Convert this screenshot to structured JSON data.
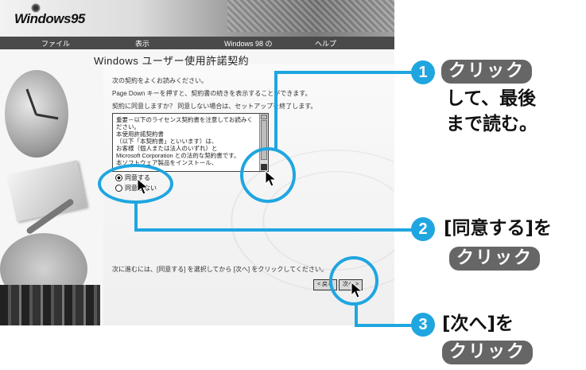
{
  "screenshot": {
    "logo": "Windows95",
    "menu": [
      "ファイル",
      "表示",
      "Windows 98 の",
      "ヘルプ"
    ],
    "wizard_title": "Windows ユーザー使用許諾契約",
    "instructions": [
      "次の契約をよくお読みください。",
      "Page Down キーを押すと、契約書の続きを表示することができます。",
      "契約に同意しますか？ 同意しない場合は、セットアップを終了します。"
    ],
    "license_lines": [
      "重要－以下のライセンス契約書を注意してお読みください。",
      "本使用許諾契約書",
      "（以下「本契約書」といいます）は、",
      "お客様（個人または法人のいずれ）と",
      "Microsoft Corporation との法的な契約書です。",
      "本ソフトウェア製品をインストール、"
    ],
    "options": [
      "同意する",
      "同意しない"
    ],
    "bottom_note": "次に進むには、[同意する] を選択してから [次へ] をクリックしてください。",
    "buttons": [
      "< 戻る",
      "次へ >"
    ]
  },
  "callouts": [
    {
      "num": "1",
      "pill": "クリック",
      "text": [
        "して、最後",
        "まで読む。"
      ]
    },
    {
      "num": "2",
      "text": "[同意する]を",
      "pill": "クリック"
    },
    {
      "num": "3",
      "text": "[次へ]を",
      "pill": "クリック"
    }
  ],
  "colors": {
    "accent": "#1fa6e0",
    "pill": "#666666"
  }
}
